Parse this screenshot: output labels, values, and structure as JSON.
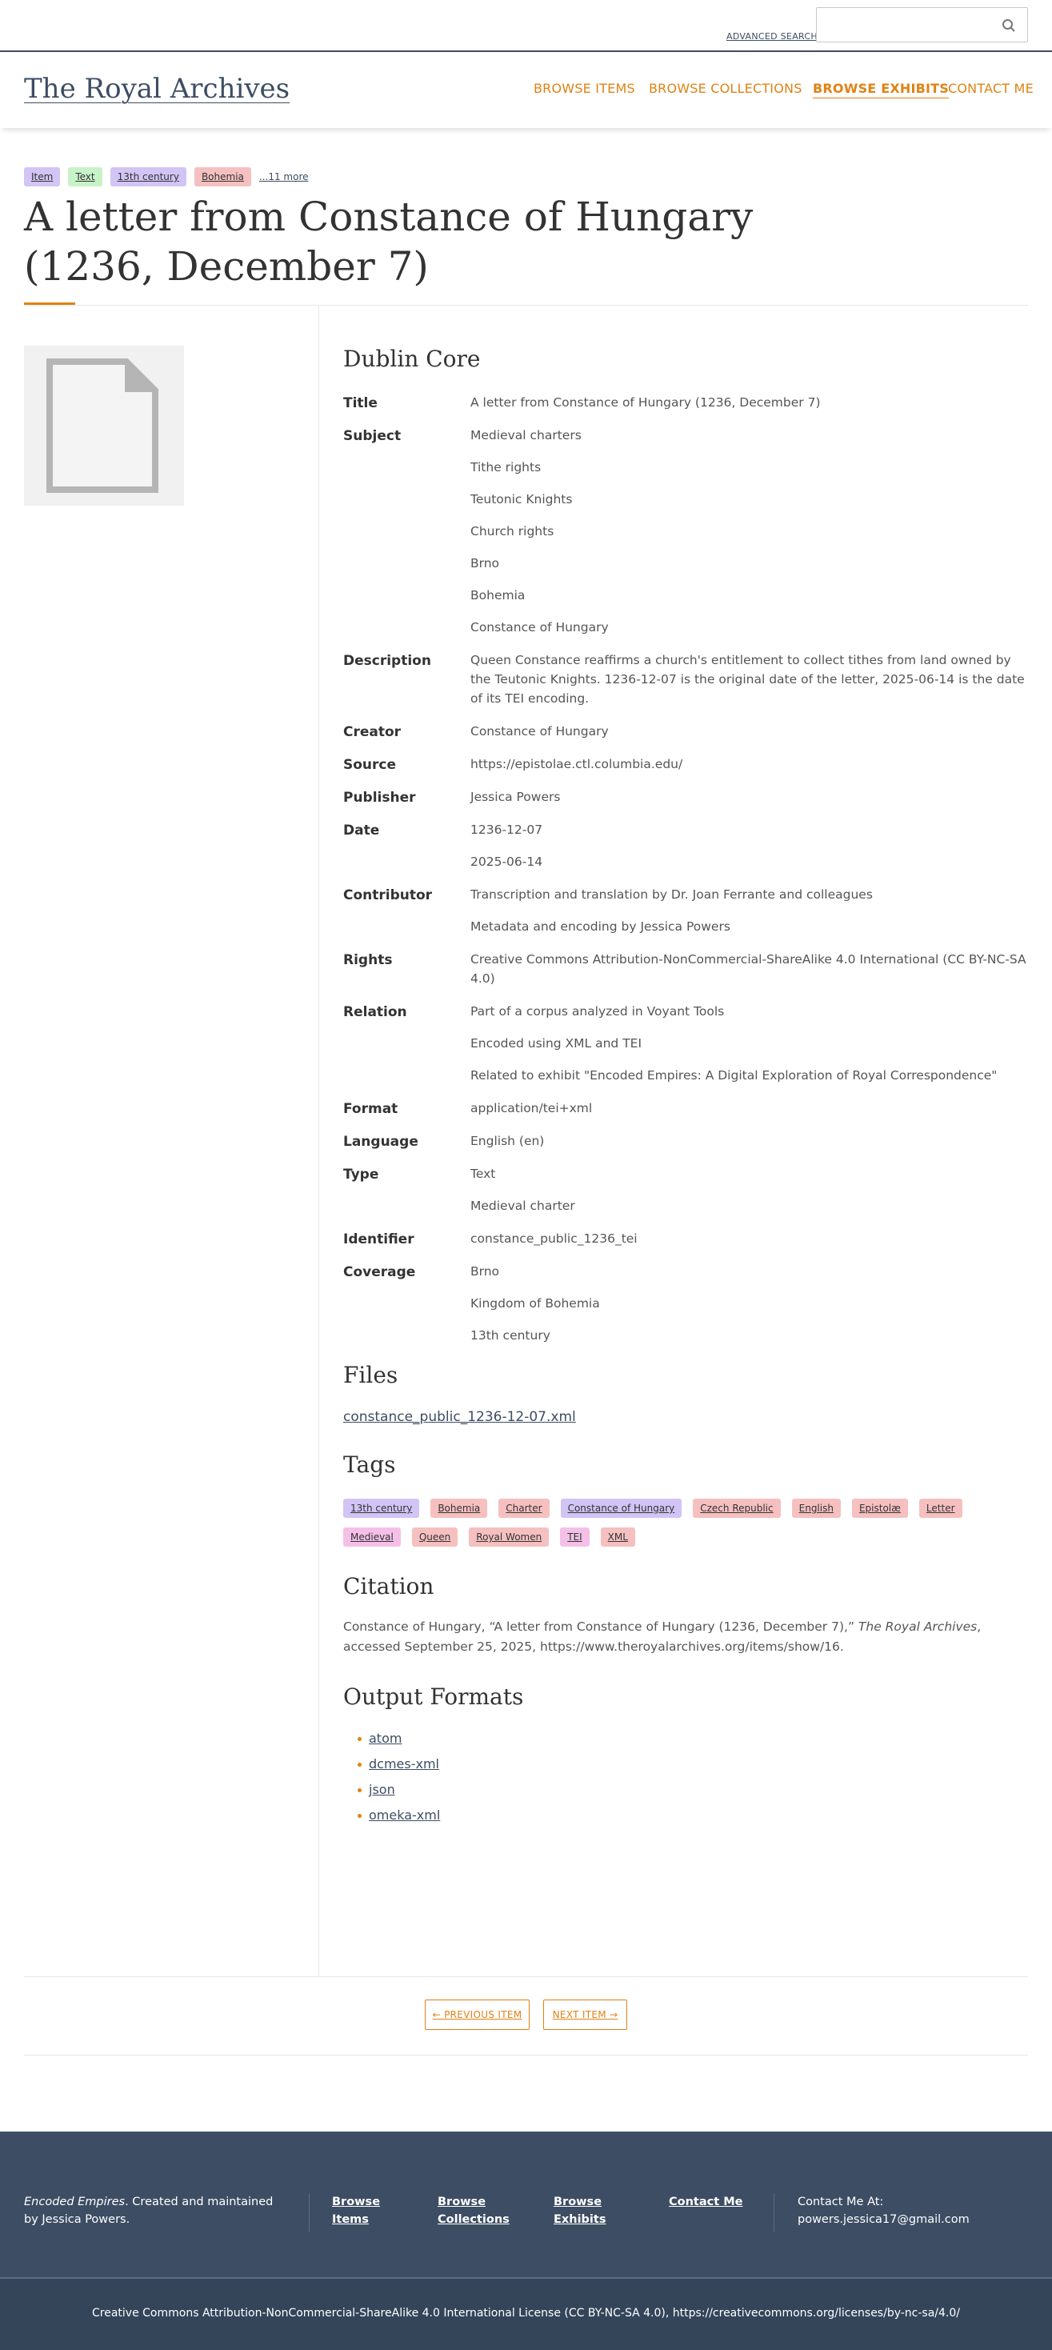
{
  "topbar": {
    "advanced_search": "ADVANCED SEARCH",
    "search_placeholder": ""
  },
  "header": {
    "site_title": "The Royal Archives",
    "nav": [
      "BROWSE ITEMS",
      "BROWSE COLLECTIONS",
      "BROWSE EXHIBITS",
      "CONTACT ME"
    ],
    "active_nav": "BROWSE EXHIBITS"
  },
  "item_tags": [
    {
      "label": "Item",
      "color": "#d2c4f5"
    },
    {
      "label": "Text",
      "color": "#c8f2c8"
    },
    {
      "label": "13th century",
      "color": "#d2c4f5"
    },
    {
      "label": "Bohemia",
      "color": "#f6c0c0"
    }
  ],
  "more_tags": "...11 more",
  "page_title": "A letter from Constance of Hungary (1236, December 7)",
  "dublin_core": {
    "heading": "Dublin Core",
    "fields": [
      {
        "label": "Title",
        "values": [
          "A letter from Constance of Hungary (1236, December 7)"
        ]
      },
      {
        "label": "Subject",
        "values": [
          "Medieval charters",
          "Tithe rights",
          "Teutonic Knights",
          "Church rights",
          "Brno",
          "Bohemia",
          "Constance of Hungary"
        ]
      },
      {
        "label": "Description",
        "values": [
          "Queen Constance reaffirms a church's entitlement to collect tithes from land owned by the Teutonic Knights. 1236-12-07 is the original date of the letter, 2025-06-14 is the date of its TEI encoding."
        ]
      },
      {
        "label": "Creator",
        "values": [
          "Constance of Hungary"
        ]
      },
      {
        "label": "Source",
        "values": [
          "https://epistolae.ctl.columbia.edu/"
        ]
      },
      {
        "label": "Publisher",
        "values": [
          "Jessica Powers"
        ]
      },
      {
        "label": "Date",
        "values": [
          "1236-12-07",
          "2025-06-14"
        ]
      },
      {
        "label": "Contributor",
        "values": [
          "Transcription and translation by Dr. Joan Ferrante and colleagues",
          "Metadata and encoding by Jessica Powers"
        ]
      },
      {
        "label": "Rights",
        "values": [
          "Creative Commons Attribution-NonCommercial-ShareAlike 4.0 International (CC BY-NC-SA 4.0)"
        ]
      },
      {
        "label": "Relation",
        "values": [
          "Part of a corpus analyzed in Voyant Tools",
          "Encoded using XML and TEI",
          "Related to exhibit \"Encoded Empires: A Digital Exploration of Royal Correspondence\""
        ]
      },
      {
        "label": "Format",
        "values": [
          "application/tei+xml"
        ]
      },
      {
        "label": "Language",
        "values": [
          "English (en)"
        ]
      },
      {
        "label": "Type",
        "values": [
          "Text",
          "Medieval charter"
        ]
      },
      {
        "label": "Identifier",
        "values": [
          "constance_public_1236_tei"
        ]
      },
      {
        "label": "Coverage",
        "values": [
          "Brno",
          "Kingdom of Bohemia",
          "13th century"
        ]
      }
    ]
  },
  "files": {
    "heading": "Files",
    "link": "constance_public_1236-12-07.xml"
  },
  "tags": {
    "heading": "Tags",
    "items": [
      {
        "label": "13th century",
        "color": "#d2c4f5"
      },
      {
        "label": "Bohemia",
        "color": "#f6c0c0"
      },
      {
        "label": "Charter",
        "color": "#f6c0c0"
      },
      {
        "label": "Constance of Hungary",
        "color": "#d2c4f5"
      },
      {
        "label": "Czech Republic",
        "color": "#f6c0c0"
      },
      {
        "label": "English",
        "color": "#f6c0c0"
      },
      {
        "label": "Epistolæ",
        "color": "#f6c0c0"
      },
      {
        "label": "Letter",
        "color": "#f6c0c0"
      },
      {
        "label": "Medieval",
        "color": "#f5c0e8"
      },
      {
        "label": "Queen",
        "color": "#f6c0c0"
      },
      {
        "label": "Royal Women",
        "color": "#f6c0c0"
      },
      {
        "label": "TEI",
        "color": "#f5c0e8"
      },
      {
        "label": "XML",
        "color": "#f6c0c0"
      }
    ]
  },
  "citation": {
    "heading": "Citation",
    "before": "Constance of Hungary, “A letter from Constance of Hungary (1236, December 7),” ",
    "source_title": "The Royal Archives",
    "after": ", accessed September 25, 2025, https://www.theroyalarchives.org/items/show/16."
  },
  "output_formats": {
    "heading": "Output Formats",
    "items": [
      "atom",
      "dcmes-xml",
      "json",
      "omeka-xml"
    ]
  },
  "pagination": {
    "previous": "← PREVIOUS ITEM",
    "next": "NEXT ITEM →"
  },
  "footer": {
    "about_title": "Encoded Empires",
    "about_rest": ". Created and maintained by Jessica Powers.",
    "links": [
      "Browse Items",
      "Browse Collections",
      "Browse Exhibits",
      "Contact Me"
    ],
    "contact_label": "Contact Me At:",
    "contact_email": "powers.jessica17@gmail.com",
    "license": "Creative Commons Attribution-NonCommercial-ShareAlike 4.0 International License (CC BY-NC-SA 4.0), https://creativecommons.org/licenses/by-nc-sa/4.0/"
  },
  "colors": {
    "accent": "#e08214",
    "navy": "#3d4d63"
  }
}
